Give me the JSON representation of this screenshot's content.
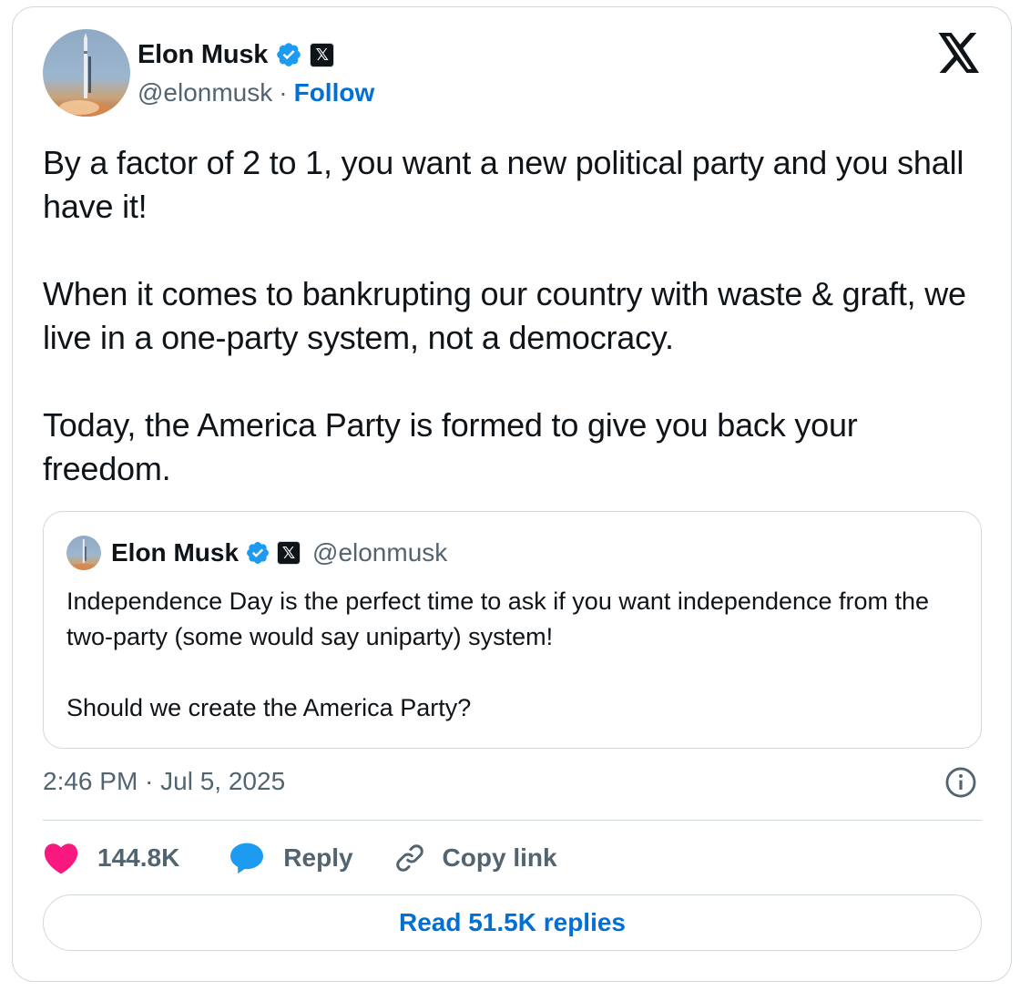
{
  "author": {
    "name": "Elon Musk",
    "handle": "@elonmusk",
    "separator": "·",
    "follow_label": "Follow"
  },
  "tweet": {
    "paragraphs": [
      "By a factor of 2 to 1, you want a new political party and you shall have it!",
      "When it comes to bankrupting our country with waste & graft, we live in a one-party system, not a democracy.",
      "Today, the America Party is formed to give you back your freedom."
    ],
    "timestamp": "2:46 PM · Jul 5, 2025"
  },
  "quote": {
    "name": "Elon Musk",
    "handle": "@elonmusk",
    "paragraphs": [
      "Independence Day is the perfect time to ask if you want independence from the two-party (some would say uniparty) system!",
      "Should we create the America Party?"
    ]
  },
  "actions": {
    "likes": "144.8K",
    "reply_label": "Reply",
    "copy_label": "Copy link"
  },
  "read_replies_label": "Read 51.5K replies",
  "icons": {
    "verified": "verified-badge-icon",
    "x_affiliate": "x-affiliate-badge-icon",
    "x_logo": "x-logo-icon",
    "info": "info-icon",
    "heart": "heart-icon",
    "reply": "reply-bubble-icon",
    "link": "link-icon"
  },
  "colors": {
    "accent": "#006fd6",
    "verified": "#1d9bf0",
    "heart": "#f91880",
    "secondary_text": "#536471",
    "border": "#cfd9de"
  }
}
